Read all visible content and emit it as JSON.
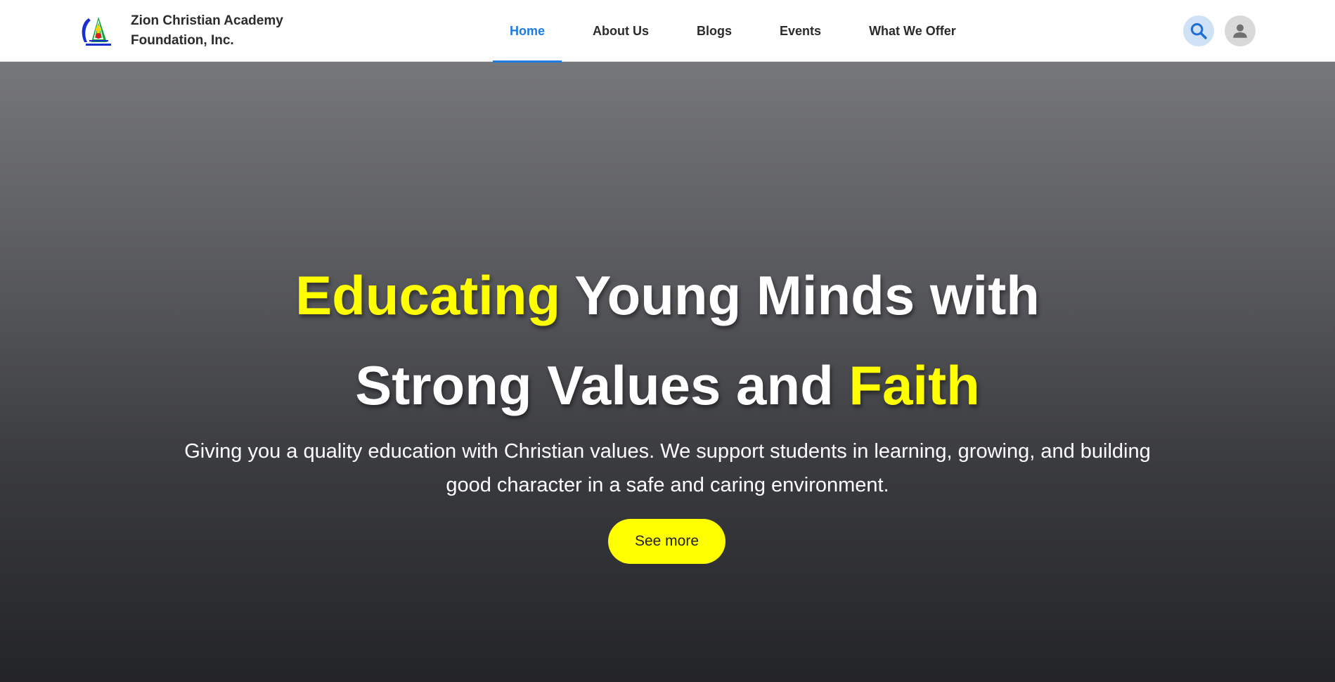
{
  "header": {
    "brand_name": "Zion Christian Academy Foundation, Inc.",
    "logo_icon": "school-logo-icon",
    "nav": [
      {
        "label": "Home",
        "active": true
      },
      {
        "label": "About Us",
        "active": false
      },
      {
        "label": "Blogs",
        "active": false
      },
      {
        "label": "Events",
        "active": false
      },
      {
        "label": "What We Offer",
        "active": false
      }
    ],
    "search_icon": "search-icon",
    "account_icon": "user-icon"
  },
  "hero": {
    "headline_line1_highlight": "Educating",
    "headline_line1_rest": "Young Minds with",
    "headline_line2_rest": "Strong Values and",
    "headline_line2_highlight": "Faith",
    "subtext": "Giving you a quality education with Christian values. We support students in learning, growing, and building good character in a safe and caring environment.",
    "cta_label": "See more"
  },
  "colors": {
    "accent": "#1e7be0",
    "highlight": "#ffff00",
    "header_bg": "#ffffff",
    "hero_top": "#76777b",
    "hero_bottom": "#232427"
  }
}
